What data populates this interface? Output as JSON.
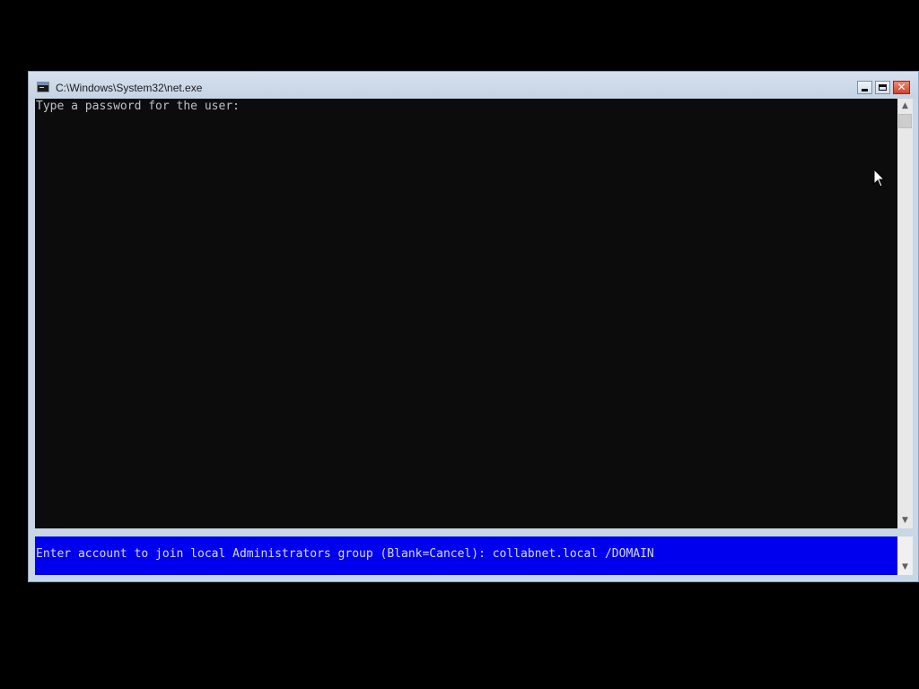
{
  "window": {
    "title": "C:\\Windows\\System32\\net.exe",
    "icon": "console-app-icon",
    "controls": {
      "minimize": "minimize-icon",
      "maximize": "maximize-icon",
      "close": "✕"
    }
  },
  "console": {
    "lines": [
      "Type a password for the user:"
    ],
    "background": "#0c0c0c",
    "foreground": "#c0c0c0"
  },
  "scrollbar": {
    "up": "▲",
    "down": "▼"
  },
  "status_pane": {
    "prompt": "Enter account to join local Administrators group (Blank=Cancel): collabnet.local /DOMAIN",
    "background": "#0000ee",
    "scroll_down": "▼"
  },
  "colors": {
    "desktop": "#000000",
    "titlebar": "#c9d6e6",
    "close_button": "#c8482f"
  }
}
